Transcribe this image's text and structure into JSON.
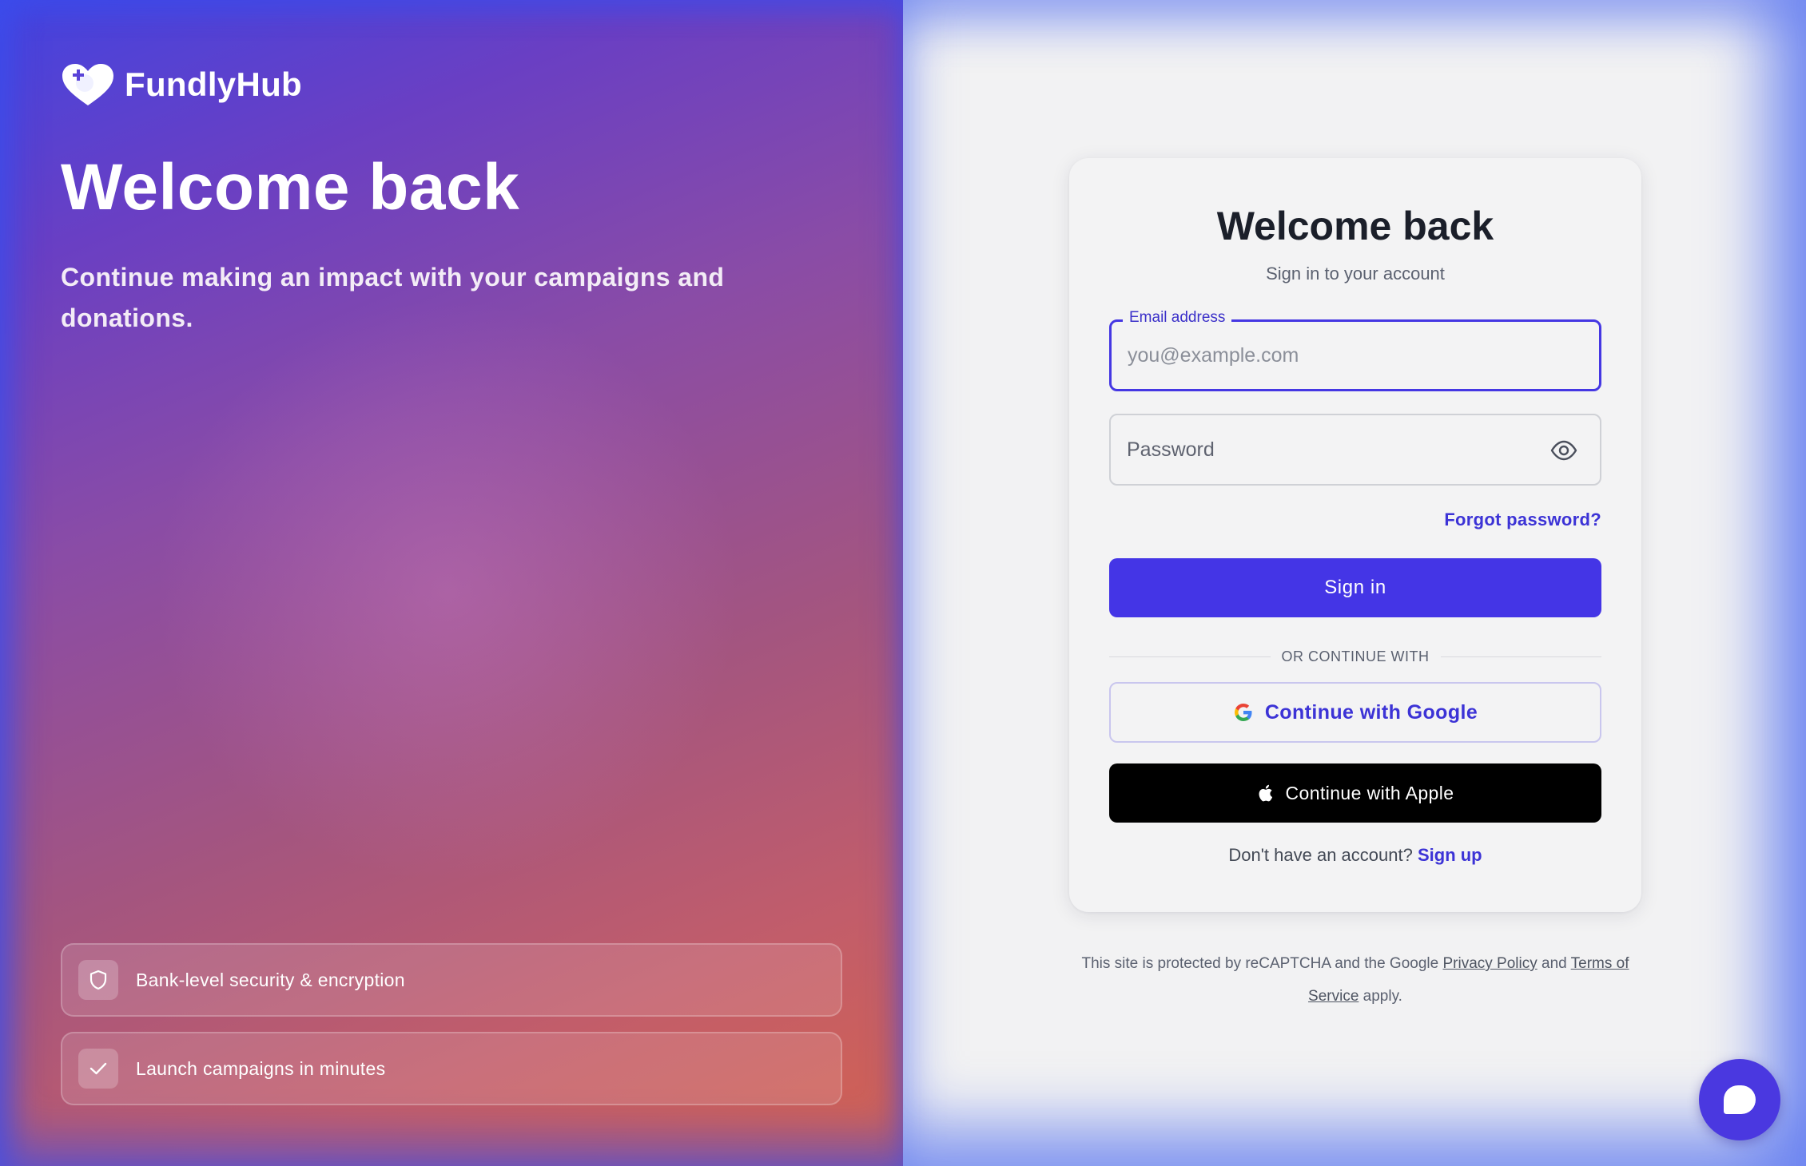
{
  "brand": {
    "name": "FundlyHub"
  },
  "hero": {
    "title": "Welcome back",
    "subtitle": "Continue making an impact with your campaigns and donations.",
    "features": [
      {
        "icon": "shield-icon",
        "label": "Bank-level security & encryption"
      },
      {
        "icon": "check-icon",
        "label": "Launch campaigns in minutes"
      }
    ]
  },
  "card": {
    "title": "Welcome back",
    "subtitle": "Sign in to your account",
    "email": {
      "label": "Email address",
      "placeholder": "you@example.com",
      "value": ""
    },
    "password": {
      "placeholder": "Password",
      "value": ""
    },
    "forgot_label": "Forgot password?",
    "signin_label": "Sign in",
    "divider_label": "OR CONTINUE WITH",
    "google_label": "Continue with Google",
    "apple_label": "Continue with Apple",
    "signup_prompt": "Don't have an account?",
    "signup_link": "Sign up"
  },
  "legal": {
    "prefix": "This site is protected by reCAPTCHA and the Google",
    "privacy_link": "Privacy Policy",
    "and": "and",
    "terms_link": "Terms of Service",
    "suffix": "apply."
  },
  "colors": {
    "accent": "#4435e6",
    "link": "#3c33d6",
    "apple_button": "#000000",
    "chat_button": "#4a38e0"
  }
}
